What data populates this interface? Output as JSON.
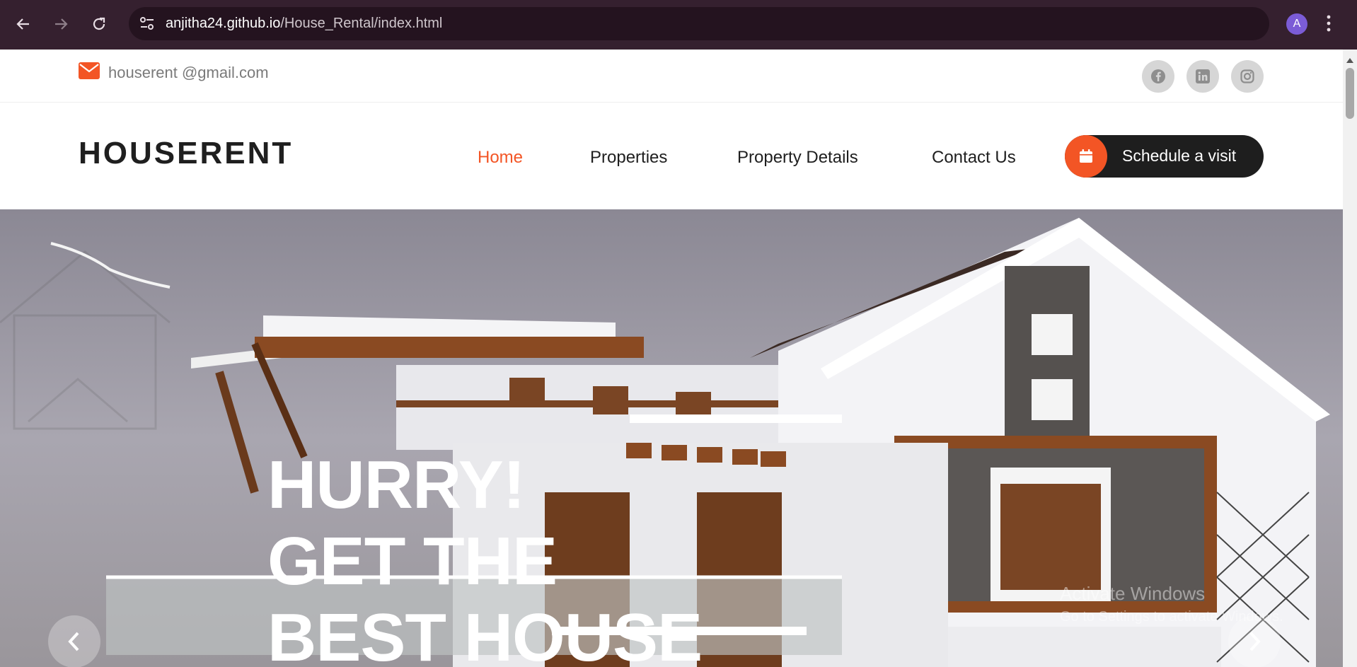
{
  "browser": {
    "url_host": "anjitha24.github.io",
    "url_path": "/House_Rental/index.html",
    "profile_initial": "A"
  },
  "topbar": {
    "email": "houserent @gmail.com",
    "social": [
      "facebook-icon",
      "linkedin-icon",
      "instagram-icon"
    ]
  },
  "header": {
    "logo": "HOUSERENT",
    "nav": [
      "Home",
      "Properties",
      "Property Details",
      "Contact Us"
    ],
    "active_nav": "Home",
    "schedule_label": "Schedule a visit"
  },
  "hero": {
    "lines": [
      "HURRY!",
      "GET THE",
      "BEST HOUSE"
    ]
  },
  "watermark": {
    "line1": "Activate Windows",
    "line2": "Go to Settings to activate Windows."
  },
  "colors": {
    "accent": "#f35525",
    "dark": "#1e1e1e",
    "chrome": "#35202f"
  }
}
